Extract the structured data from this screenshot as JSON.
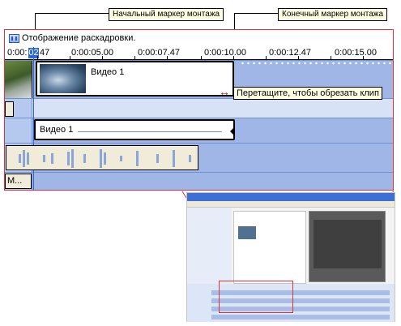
{
  "callouts": {
    "start_marker": "Начальный маркер монтажа",
    "end_marker": "Конечный маркер монтажа"
  },
  "storyboard": {
    "label": "Отображение раскадровки."
  },
  "ruler": {
    "labels": [
      "0:00:",
      "02",
      "47",
      "0:00:05.00",
      "0:00:07.47",
      "0:00:10.00",
      "0:00:12.47",
      "0:00:15.00"
    ]
  },
  "video_clip": {
    "label": "Видео 1"
  },
  "overlay_clip": {
    "label": "Видео 1"
  },
  "tooltip": {
    "text": "Перетащите, чтобы обрезать клип"
  },
  "title_track": {
    "label": "М..."
  },
  "colors": {
    "timeline_blue": "#9fb6e6",
    "highlight_red": "#e0323a",
    "marker_blue": "#2a68d0"
  }
}
